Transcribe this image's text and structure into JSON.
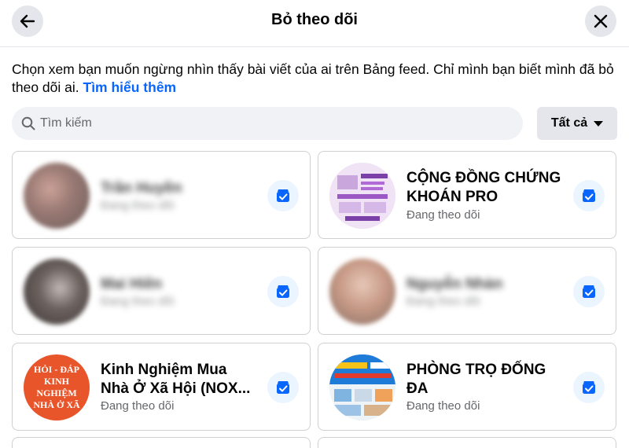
{
  "header": {
    "title": "Bỏ theo dõi",
    "back_icon": "arrow-left-icon",
    "close_icon": "close-icon"
  },
  "description": {
    "text": "Chọn xem bạn muốn ngừng nhìn thấy bài viết của ai trên Bảng feed. Chỉ mình bạn biết mình đã bỏ theo dõi ai.",
    "link": "Tìm hiểu thêm"
  },
  "search": {
    "placeholder": "Tìm kiếm",
    "value": ""
  },
  "filter": {
    "selected": "Tất cả"
  },
  "colors": {
    "accent": "#0866ff",
    "follow_button_bg": "#ebf5ff",
    "secondary_text": "#65676b"
  },
  "cards": [
    {
      "name": "Trần Huyền",
      "status": "Đang theo dõi"
    },
    {
      "name": "CỘNG ĐỒNG CHỨNG KHOÁN PRO",
      "status": "Đang theo dõi"
    },
    {
      "name": "Mai Hiên",
      "status": "Đang theo dõi"
    },
    {
      "name": "Nguyễn Nhàn",
      "status": "Đang theo dõi"
    },
    {
      "name": "Kinh Nghiệm Mua Nhà Ở Xã Hội (NOX...",
      "status": "Đang theo dõi",
      "avatar_lines": [
        "HỎI - ĐÁP",
        "KINH NGHIỆM",
        "NHÀ Ở XÃ"
      ]
    },
    {
      "name": "PHÒNG TRỌ ĐỐNG ĐA",
      "status": "Đang theo dõi"
    }
  ]
}
